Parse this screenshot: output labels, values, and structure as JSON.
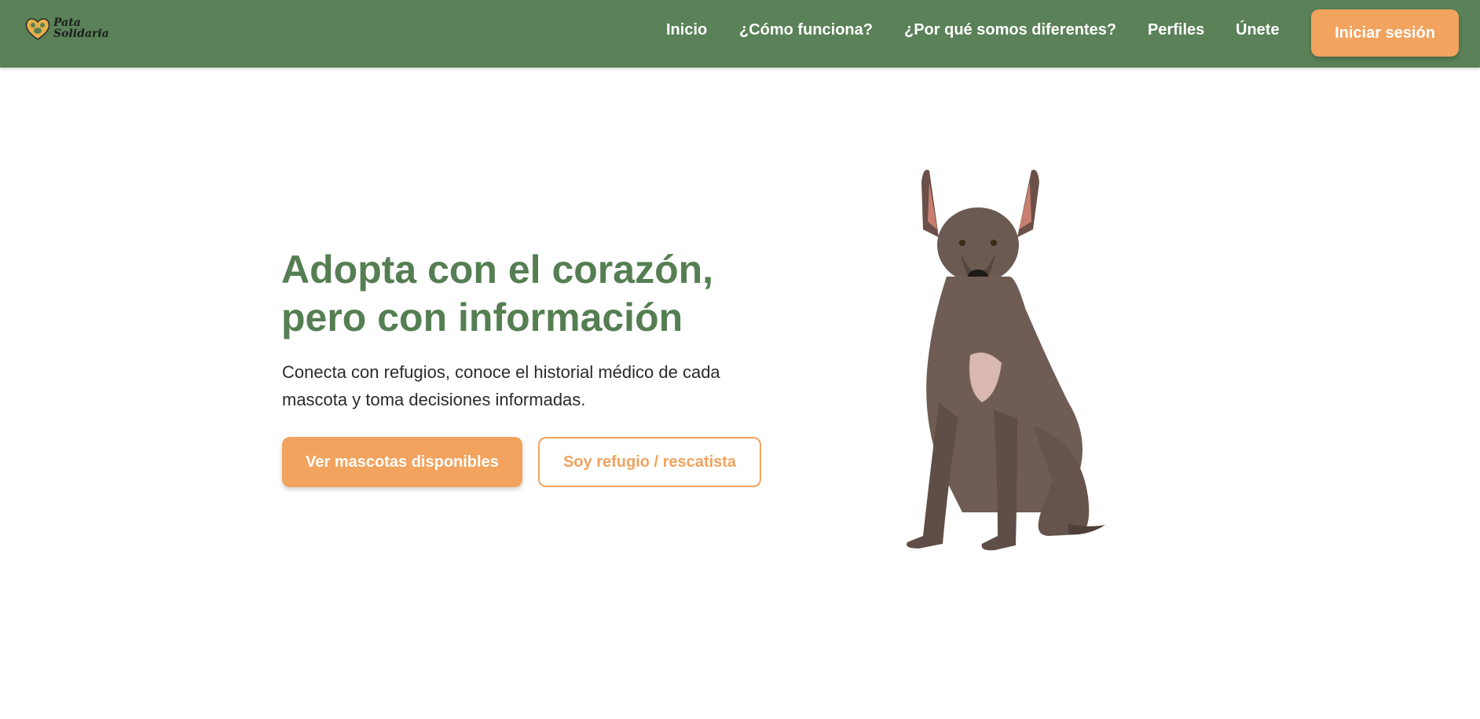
{
  "brand": {
    "name_line1": "Pata",
    "name_line2": "Solidaria"
  },
  "nav": {
    "links": [
      "Inicio",
      "¿Cómo funciona?",
      "¿Por qué somos diferentes?",
      "Perfiles",
      "Únete"
    ],
    "login_label": "Iniciar sesión"
  },
  "hero": {
    "title_line1": "Adopta con el corazón,",
    "title_line2": "pero con información",
    "subtitle_line1": "Conecta con refugios, conoce el historial médico de cada",
    "subtitle_line2": "mascota y toma decisiones informadas.",
    "primary_cta": "Ver mascotas disponibles",
    "secondary_cta": "Soy refugio / rescatista"
  },
  "colors": {
    "navbar": "#5a8157",
    "accent": "#f2a35e",
    "heading": "#557e52"
  }
}
